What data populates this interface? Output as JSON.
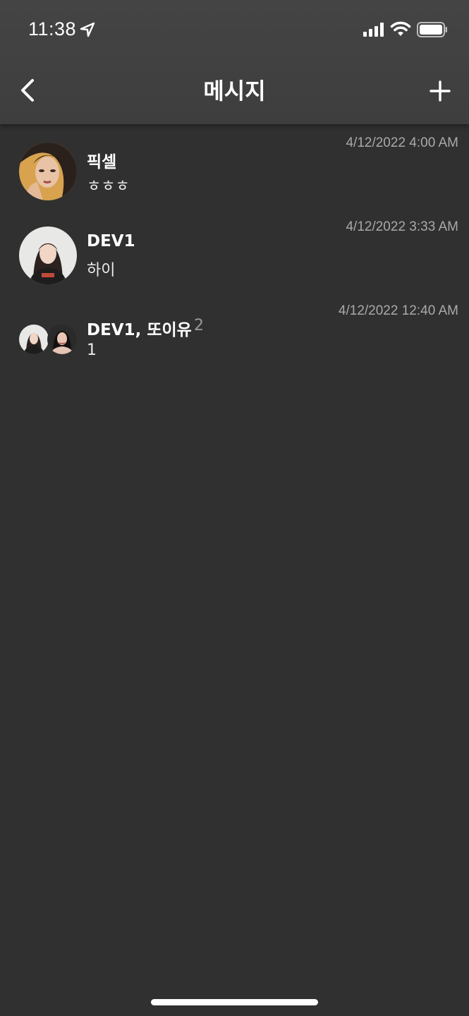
{
  "status_bar": {
    "time": "11:38",
    "icons": [
      "location-arrow-icon",
      "signal-bars-icon",
      "wifi-icon",
      "battery-icon"
    ]
  },
  "header": {
    "title": "메시지",
    "back_icon": "chevron-left-icon",
    "add_icon": "plus-icon"
  },
  "conversations": [
    {
      "name": "픽셀",
      "message": "ㅎㅎㅎ",
      "time": "4/12/2022 4:00 AM",
      "member_count": ""
    },
    {
      "name": "DEV1",
      "message": "하이",
      "time": "4/12/2022 3:33 AM",
      "member_count": ""
    },
    {
      "name": "DEV1, 또이유",
      "message": "1",
      "time": "4/12/2022 12:40 AM",
      "member_count": "2"
    }
  ],
  "colors": {
    "background": "#303030",
    "header": "#444444",
    "timestamp": "#a9a9a9",
    "member_count": "#9a9a9a"
  }
}
